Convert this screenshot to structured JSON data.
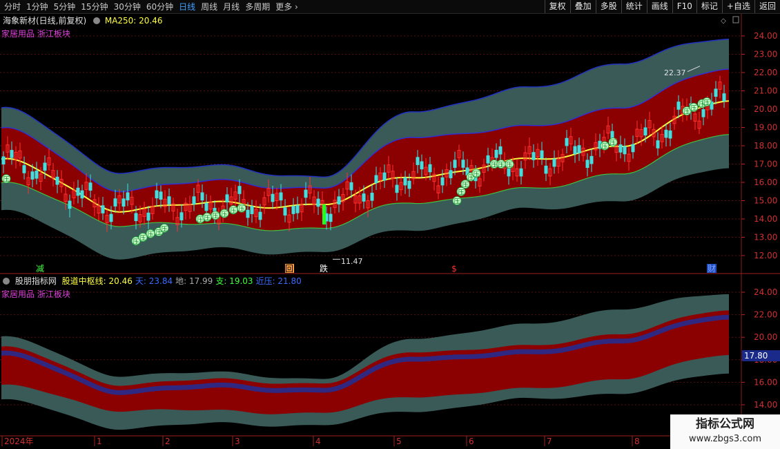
{
  "toolbar": {
    "periods": [
      "分时",
      "1分钟",
      "5分钟",
      "15分钟",
      "30分钟",
      "60分钟",
      "日线",
      "周线",
      "月线",
      "多周期",
      "更多"
    ],
    "active_period": "日线",
    "tools": [
      "复权",
      "叠加",
      "多股",
      "统计",
      "画线",
      "F10",
      "标记",
      "+自选",
      "返回"
    ]
  },
  "main_panel": {
    "stock_title": "海象新材(日线,前复权)",
    "ma_label": "MA250: 20.46",
    "sector": "家居用品 浙江板块",
    "price_ticks": [
      "24.00",
      "23.00",
      "22.00",
      "21.00",
      "20.00",
      "19.00",
      "18.00",
      "17.00",
      "16.00",
      "15.00",
      "14.00",
      "13.00",
      "12.00"
    ],
    "high_label": "22.37",
    "low_label": "11.47",
    "markers": [
      "减",
      "回",
      "跌",
      "$",
      "财"
    ],
    "badge": "压"
  },
  "indicator_panel": {
    "name": "股朋指标网",
    "items": [
      {
        "label": "股道中枢线: 20.46",
        "color": "#ffff40"
      },
      {
        "label": "天: 23.84",
        "color": "#3a6cff"
      },
      {
        "label": "地: 17.99",
        "color": "#aaaaaa"
      },
      {
        "label": "支: 19.03",
        "color": "#40ff40"
      },
      {
        "label": "近压: 21.80",
        "color": "#3a6cff"
      }
    ],
    "sector": "家居用品 浙江板块",
    "ticks": [
      "24.00",
      "22.00",
      "20.00",
      "18.00",
      "16.00",
      "14.00"
    ],
    "cursor_value": "17.80"
  },
  "time_axis": {
    "labels": [
      "2024年",
      "1",
      "2",
      "3",
      "4",
      "5",
      "6",
      "7",
      "8"
    ]
  },
  "watermark": {
    "line1": "指标公式网",
    "line2": "www.zbgs3.com"
  },
  "colors": {
    "outer_band": "#3a5a58",
    "inner_band": "#8b0000",
    "center_line": "#ffff40",
    "support_line": "#40c040",
    "upper_line": "#2020c0",
    "candle_up": "#ff3030",
    "candle_down": "#40e0e0"
  },
  "chart_data": {
    "type": "line",
    "title": "海象新材(日线,前复权)",
    "x": [
      "2024-01",
      "2024-02",
      "2024-03",
      "2024-04",
      "2024-05",
      "2024-06",
      "2024-07",
      "2024-08"
    ],
    "ylim": [
      11.5,
      24.5
    ],
    "series": [
      {
        "name": "股道中枢线",
        "values": [
          17.2,
          14.6,
          14.8,
          14.8,
          16.4,
          17.1,
          18.1,
          20.46
        ]
      },
      {
        "name": "天",
        "values": [
          20.0,
          16.7,
          16.8,
          16.3,
          20.0,
          21.0,
          22.6,
          23.84
        ]
      },
      {
        "name": "地",
        "values": [
          15.6,
          13.2,
          13.5,
          13.4,
          14.7,
          15.6,
          16.3,
          17.99
        ]
      },
      {
        "name": "支",
        "values": [
          16.3,
          14.2,
          14.0,
          13.9,
          15.4,
          15.9,
          17.0,
          19.03
        ]
      },
      {
        "name": "近压",
        "values": [
          18.5,
          15.3,
          15.6,
          15.3,
          18.2,
          18.5,
          19.8,
          21.8
        ]
      }
    ],
    "annotations": [
      {
        "text": "22.37",
        "kind": "period high"
      },
      {
        "text": "11.47",
        "kind": "period low"
      }
    ]
  }
}
